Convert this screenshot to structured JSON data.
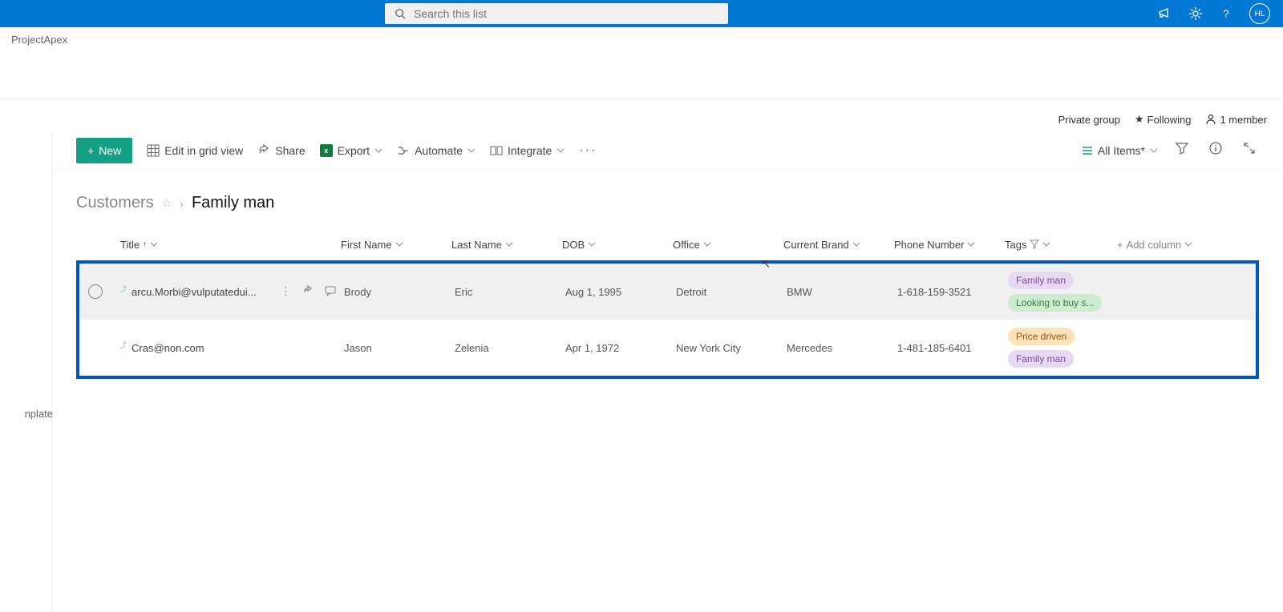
{
  "search": {
    "placeholder": "Search this list"
  },
  "avatar": "HL",
  "site_name": "ProjectApex",
  "left_gutter_text": "nplate",
  "page_meta": {
    "private": "Private group",
    "following": "Following",
    "members": "1 member"
  },
  "toolbar": {
    "new": "New",
    "edit_grid": "Edit in grid view",
    "share": "Share",
    "export": "Export",
    "automate": "Automate",
    "integrate": "Integrate",
    "view_name": "All Items*"
  },
  "breadcrumb": {
    "parent": "Customers",
    "current": "Family man"
  },
  "columns": {
    "title": "Title",
    "first_name": "First Name",
    "last_name": "Last Name",
    "dob": "DOB",
    "office": "Office",
    "brand": "Current Brand",
    "phone": "Phone Number",
    "tags": "Tags",
    "add": "Add column"
  },
  "rows": [
    {
      "title": "arcu.Morbi@vulputatedui...",
      "first_name": "Brody",
      "last_name": "Eric",
      "dob": "Aug 1, 1995",
      "office": "Detroit",
      "brand": "BMW",
      "phone": "1-618-159-3521",
      "tag1": "Family man",
      "tag2": "Looking to buy s..."
    },
    {
      "title": "Cras@non.com",
      "first_name": "Jason",
      "last_name": "Zelenia",
      "dob": "Apr 1, 1972",
      "office": "New York City",
      "brand": "Mercedes",
      "phone": "1-481-185-6401",
      "tag1": "Price driven",
      "tag2": "Family man"
    }
  ]
}
